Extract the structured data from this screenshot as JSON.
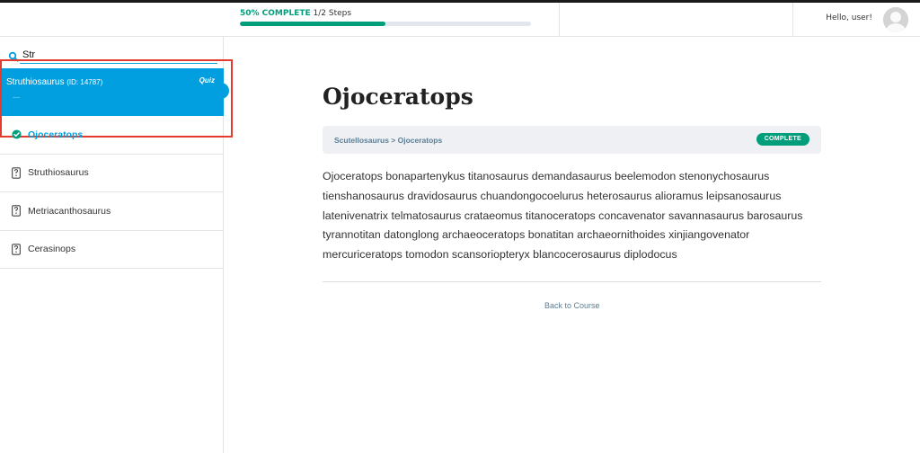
{
  "header": {
    "progress_percent_label": "50% COMPLETE",
    "progress_steps_label": "1/2 Steps",
    "progress_fraction": 0.5,
    "greeting": "Hello, user!",
    "avatar_icon": "user-avatar-icon"
  },
  "sidebar": {
    "search": {
      "value": "Str",
      "icon": "search-icon"
    },
    "search_result": {
      "name": "Struthiosaurus",
      "id_label": "(ID: 14787)",
      "type": "Quiz"
    },
    "lessons": [
      {
        "label": "Ojoceratops",
        "icon": "check-circle-icon",
        "active": true
      },
      {
        "label": "Struthiosaurus",
        "icon": "quiz-icon",
        "active": false
      },
      {
        "label": "Metriacanthosaurus",
        "icon": "quiz-icon",
        "active": false
      },
      {
        "label": "Cerasinops",
        "icon": "quiz-icon",
        "active": false
      }
    ]
  },
  "main": {
    "title": "Ojoceratops",
    "breadcrumb": "Scutellosaurus > Ojoceratops",
    "status": "COMPLETE",
    "body": "Ojoceratops bonapartenykus titanosaurus demandasaurus beelemodon stenonychosaurus tienshanosaurus dravidosaurus chuandongocoelurus heterosaurus alioramus leipsanosaurus latenivenatrix telmatosaurus crataeomus titanoceratops concavenator savannasaurus barosaurus tyrannotitan datonglong archaeoceratops bonatitan archaeornithoides xinjiangovenator mercuriceratops tomodon scansoriopteryx blancocerosaurus diplodocus",
    "back_link": "Back to Course"
  },
  "colors": {
    "accent_blue": "#019fe0",
    "accent_green": "#019e7c",
    "highlight_red": "#e33b2e"
  }
}
